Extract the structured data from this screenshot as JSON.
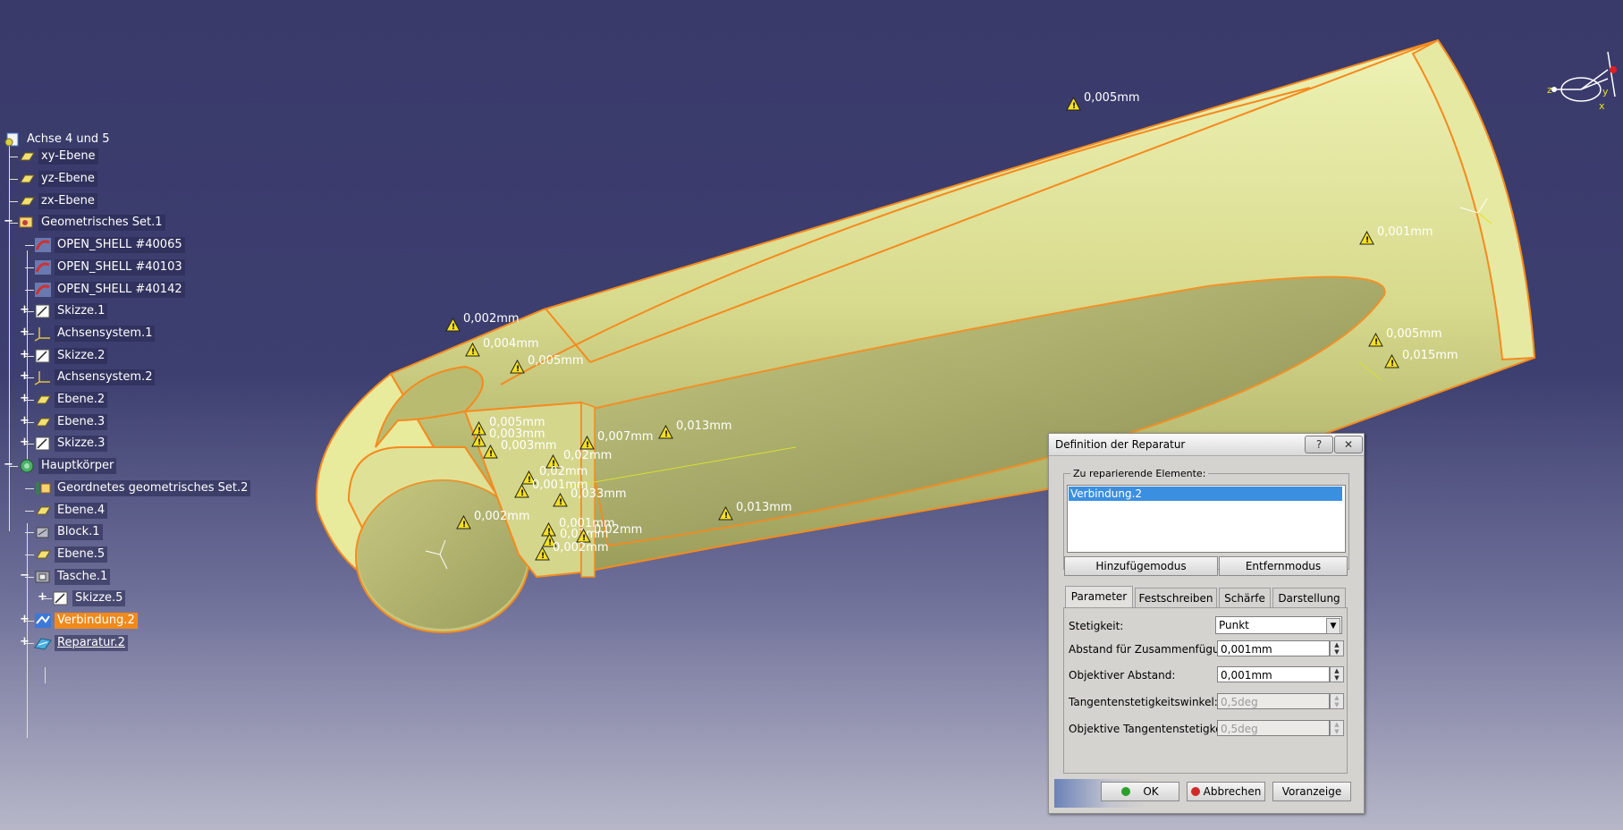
{
  "tree": {
    "root": "Achse 4 und 5",
    "items": [
      {
        "label": "xy-Ebene",
        "icon": "plane-icon"
      },
      {
        "label": "yz-Ebene",
        "icon": "plane-icon"
      },
      {
        "label": "zx-Ebene",
        "icon": "plane-icon"
      },
      {
        "label": "Geometrisches Set.1",
        "icon": "geometrical-set-icon"
      },
      {
        "label": "OPEN_SHELL #40065",
        "icon": "open-shell-icon"
      },
      {
        "label": "OPEN_SHELL #40103",
        "icon": "open-shell-icon"
      },
      {
        "label": "OPEN_SHELL #40142",
        "icon": "open-shell-icon"
      },
      {
        "label": "Skizze.1",
        "icon": "sketch-icon"
      },
      {
        "label": "Achsensystem.1",
        "icon": "axis-system-icon"
      },
      {
        "label": "Skizze.2",
        "icon": "sketch-icon"
      },
      {
        "label": "Achsensystem.2",
        "icon": "axis-system-icon"
      },
      {
        "label": "Ebene.2",
        "icon": "plane-icon"
      },
      {
        "label": "Ebene.3",
        "icon": "plane-icon"
      },
      {
        "label": "Skizze.3",
        "icon": "sketch-icon"
      },
      {
        "label": "Hauptkörper",
        "icon": "body-icon"
      },
      {
        "label": "Geordnetes geometrisches Set.2",
        "icon": "ordered-set-icon"
      },
      {
        "label": "Ebene.4",
        "icon": "plane-icon"
      },
      {
        "label": "Block.1",
        "icon": "pad-icon"
      },
      {
        "label": "Ebene.5",
        "icon": "plane-icon"
      },
      {
        "label": "Tasche.1",
        "icon": "pocket-icon"
      },
      {
        "label": "Skizze.5",
        "icon": "sketch-icon"
      },
      {
        "label": "Verbindung.2",
        "icon": "join-icon"
      },
      {
        "label": "Reparatur.2",
        "icon": "healing-icon"
      }
    ]
  },
  "annotations": [
    "0,005mm",
    "0,001mm",
    "0,005mm",
    "0,015mm",
    "0,002mm",
    "0,004mm",
    "0,005mm",
    "0,005mm",
    "0,003mm",
    "0,003mm",
    "0,007mm",
    "0,013mm",
    "0,02mm",
    "0,013mm",
    "0,02mm",
    "0,001mm",
    "0,033mm",
    "0,002mm",
    "0,001mm",
    "0,01mm",
    "0,02mm",
    "0,002mm"
  ],
  "dialog": {
    "title": "Definition der Reparatur",
    "help": "?",
    "close": "✕",
    "group_label": "Zu reparierende Elemente:",
    "list_items": [
      "Verbindung.2"
    ],
    "add_mode": "Hinzufügemodus",
    "remove_mode": "Entfernmodus",
    "tabs": [
      "Parameter",
      "Festschreiben",
      "Schärfe",
      "Darstellung"
    ],
    "continuity_label": "Stetigkeit:",
    "continuity_value": "Punkt",
    "merge_label": "Abstand für Zusammenfügung",
    "merge_value": "0,001mm",
    "target_label": "Objektiver Abstand:",
    "target_value": "0,001mm",
    "tangent_angle_label": "Tangentenstetigkeitswinkel:",
    "tangent_angle_value": "0,5deg",
    "target_tangent_label": "Objektive Tangentenstetigkeit:",
    "target_tangent_value": "0,5deg",
    "ok": "OK",
    "cancel": "Abbrechen",
    "preview": "Voranzeige"
  },
  "compass": {
    "x": "x",
    "y": "y",
    "z": "z"
  },
  "colors": {
    "model": "#ecf0a8",
    "edge": "#f58a1e",
    "selection": "#f08a1c",
    "list_selected": "#3b8fe0"
  }
}
